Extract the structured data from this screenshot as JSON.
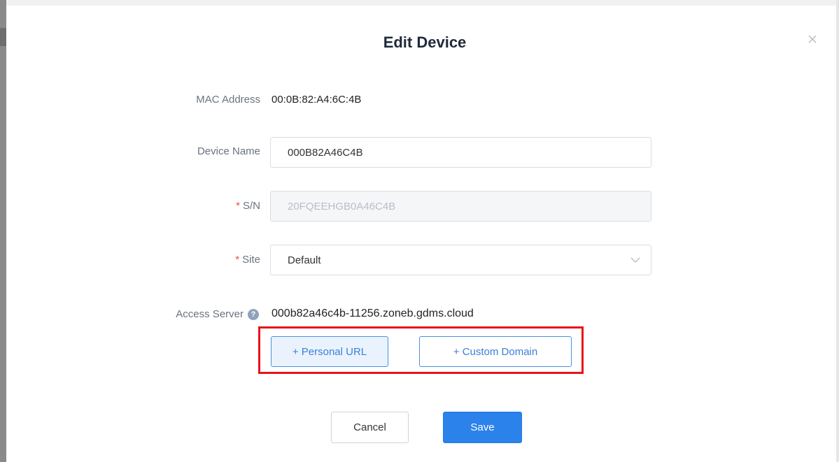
{
  "dialog": {
    "title": "Edit Device",
    "close_icon": "close-icon"
  },
  "fields": {
    "mac": {
      "label": "MAC Address",
      "value": "00:0B:82:A4:6C:4B"
    },
    "device_name": {
      "label": "Device Name",
      "value": "000B82A46C4B"
    },
    "sn": {
      "required_mark": "*",
      "label": "S/N",
      "value": "20FQEEHGB0A46C4B"
    },
    "site": {
      "required_mark": "*",
      "label": "Site",
      "value": "Default"
    },
    "access_server": {
      "label": "Access Server",
      "help_icon": "question-icon",
      "value": "000b82a46c4b-11256.zoneb.gdms.cloud"
    }
  },
  "access_buttons": {
    "personal_url": "+ Personal URL",
    "custom_domain": "+ Custom Domain"
  },
  "footer": {
    "cancel": "Cancel",
    "save": "Save"
  },
  "colors": {
    "primary": "#2b82ea",
    "highlight": "#e8141b",
    "required": "#f04b4b"
  }
}
